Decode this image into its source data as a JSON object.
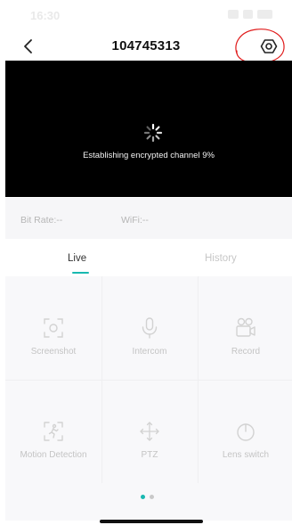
{
  "status_bar": {
    "time": "16:30"
  },
  "header": {
    "title": "104745313",
    "back_icon": "chevron-left-icon",
    "settings_icon": "settings-icon"
  },
  "video": {
    "status_text": "Establishing encrypted channel 9%",
    "loading_icon": "spinner-icon"
  },
  "info": {
    "bit_rate": "Bit Rate:--",
    "wifi": "WiFi:--"
  },
  "tabs": [
    {
      "label": "Live",
      "active": true
    },
    {
      "label": "History",
      "active": false
    }
  ],
  "controls": [
    {
      "label": "Screenshot",
      "icon": "screenshot-icon"
    },
    {
      "label": "Intercom",
      "icon": "microphone-icon"
    },
    {
      "label": "Record",
      "icon": "record-icon"
    },
    {
      "label": "Motion Detection",
      "icon": "motion-detection-icon"
    },
    {
      "label": "PTZ",
      "icon": "ptz-icon"
    },
    {
      "label": "Lens switch",
      "icon": "power-icon"
    }
  ],
  "pager": {
    "current": 1,
    "total": 2
  },
  "colors": {
    "accent": "#18b8b0",
    "annotation": "#e01b1b",
    "video_bg": "#000000"
  }
}
